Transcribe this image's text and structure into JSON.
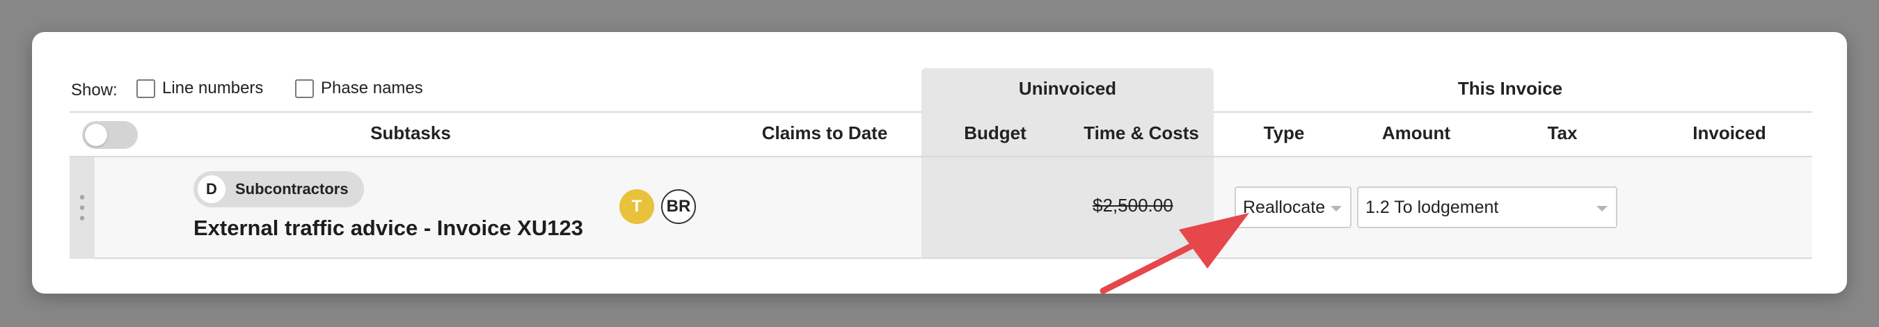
{
  "show": {
    "label": "Show:",
    "options": [
      {
        "label": "Line numbers",
        "checked": false
      },
      {
        "label": "Phase names",
        "checked": false
      }
    ]
  },
  "group_headers": {
    "uninvoiced": "Uninvoiced",
    "this_invoice": "This Invoice"
  },
  "columns": {
    "subtasks": "Subtasks",
    "claims_to_date": "Claims to Date",
    "budget": "Budget",
    "time_costs": "Time & Costs",
    "type": "Type",
    "amount": "Amount",
    "tax": "Tax",
    "invoiced": "Invoiced"
  },
  "row": {
    "phase_letter": "D",
    "phase_name": "Subcontractors",
    "title": "External traffic advice - Invoice XU123",
    "assignees": [
      "T",
      "BR"
    ],
    "time_costs": "$2,500.00",
    "type_value": "Reallocate",
    "allocation_value": "1.2 To lodgement"
  },
  "colors": {
    "backdrop": "#878787",
    "uninvoiced_shade": "#e6e6e6",
    "avatar_t": "#e8c23a",
    "annotation_arrow": "#e5474a"
  }
}
